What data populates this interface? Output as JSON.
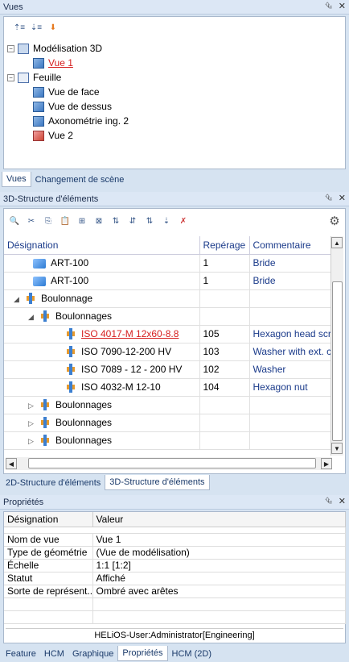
{
  "vues_panel": {
    "title": "Vues",
    "pin": "⮴",
    "close": "✕",
    "tree": [
      {
        "label": "Modélisation 3D",
        "expander": "−"
      },
      {
        "label": "Vue 1"
      },
      {
        "label": "Feuille",
        "expander": "−"
      },
      {
        "label": "Vue de face"
      },
      {
        "label": "Vue de dessus"
      },
      {
        "label": "Axonométrie ing. 2"
      },
      {
        "label": "Vue 2"
      }
    ],
    "tabs": [
      "Vues",
      "Changement de scène"
    ]
  },
  "structure_panel": {
    "title": "3D-Structure d'éléments",
    "pin": "⮴",
    "close": "✕",
    "gear": "⚙",
    "columns": [
      "Désignation",
      "Repérage",
      "Commentaire"
    ],
    "rows": [
      {
        "name": "ART-100",
        "rep": "1",
        "comment": "Bride",
        "icon": "cube-icon"
      },
      {
        "name": "ART-100",
        "rep": "1",
        "comment": "Bride",
        "icon": "cube-icon"
      },
      {
        "name": "Boulonnage",
        "rep": "",
        "comment": "",
        "icon": "assembly-icon",
        "expander": "◢"
      },
      {
        "name": "Boulonnages",
        "rep": "",
        "comment": "",
        "icon": "bolt-group-icon",
        "expander": "◢"
      },
      {
        "name": "ISO 4017-M 12x60-8.8",
        "rep": "105",
        "comment": "Hexagon head scre",
        "icon": "bolt-icon"
      },
      {
        "name": "ISO 7090-12-200 HV",
        "rep": "103",
        "comment": "Washer with ext. ch",
        "icon": "bolt-icon"
      },
      {
        "name": "ISO 7089 - 12 - 200 HV",
        "rep": "102",
        "comment": "Washer",
        "icon": "bolt-icon"
      },
      {
        "name": "ISO 4032-M 12-10",
        "rep": "104",
        "comment": "Hexagon nut",
        "icon": "bolt-icon"
      },
      {
        "name": "Boulonnages",
        "rep": "",
        "comment": "",
        "icon": "bolt-group-icon",
        "expander": "▷"
      },
      {
        "name": "Boulonnages",
        "rep": "",
        "comment": "",
        "icon": "bolt-group-icon",
        "expander": "▷"
      },
      {
        "name": "Boulonnages",
        "rep": "",
        "comment": "",
        "icon": "bolt-group-icon",
        "expander": "▷"
      }
    ],
    "tabs": [
      "2D-Structure d'éléments",
      "3D-Structure d'éléments"
    ],
    "scroll_up": "▲",
    "scroll_down": "▼",
    "scroll_left": "◀",
    "scroll_right": "▶"
  },
  "props_panel": {
    "title": "Propriétés",
    "pin": "⮴",
    "close": "✕",
    "columns": [
      "Désignation",
      "Valeur"
    ],
    "rows": [
      {
        "key": "Nom de vue",
        "value": "Vue 1"
      },
      {
        "key": "Type de géométrie",
        "value": "(Vue de modélisation)"
      },
      {
        "key": "Échelle",
        "value": "1:1 [1:2]"
      },
      {
        "key": "Statut",
        "value": "Affiché"
      },
      {
        "key": "Sorte de représent...",
        "value": "Ombré avec arêtes"
      }
    ],
    "status": "HELiOS-User:Administrator[Engineering]",
    "tabs": [
      "Feature",
      "HCM",
      "Graphique",
      "Propriétés",
      "HCM (2D)"
    ]
  }
}
